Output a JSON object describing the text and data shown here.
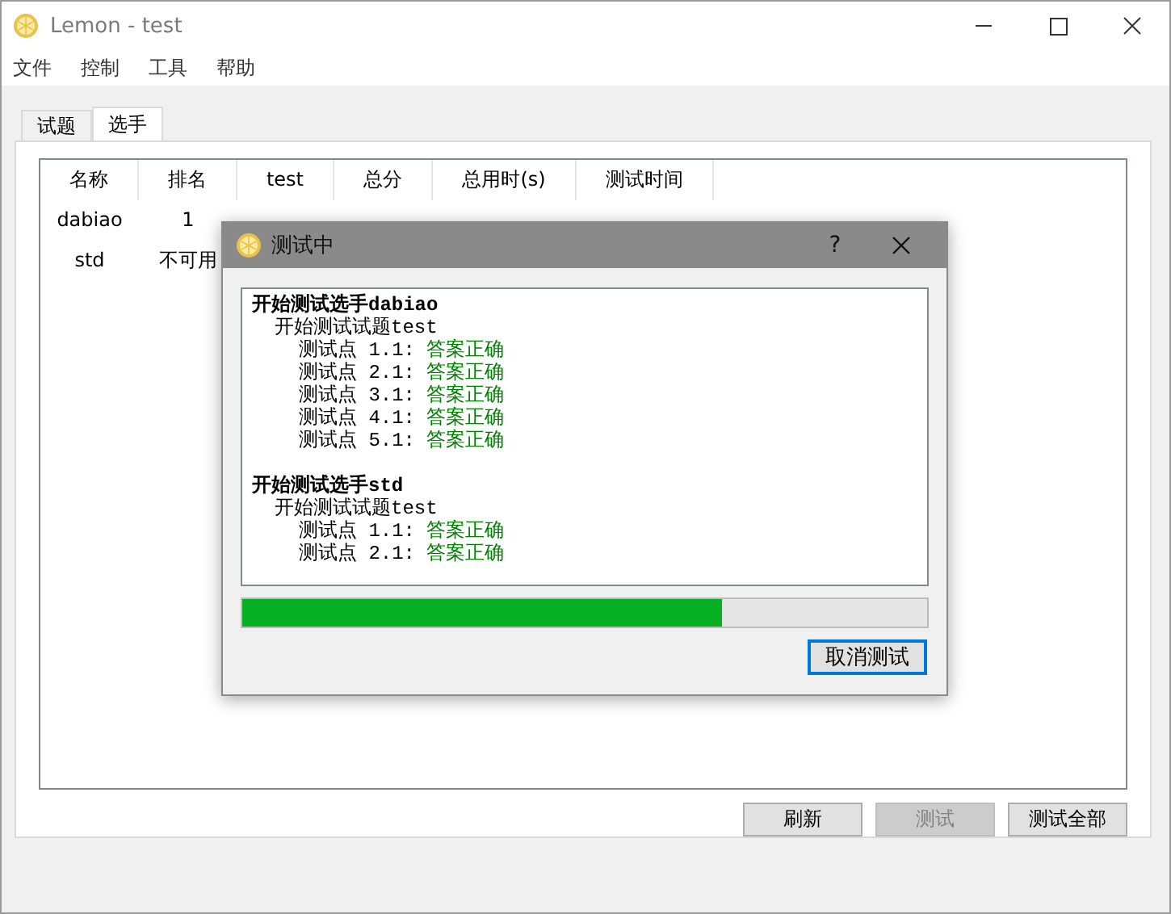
{
  "window": {
    "title": "Lemon - test",
    "active": false
  },
  "menu": [
    "文件",
    "控制",
    "工具",
    "帮助"
  ],
  "tabs": [
    {
      "label": "试题",
      "selected": false
    },
    {
      "label": "选手",
      "selected": true
    }
  ],
  "table": {
    "columns": [
      "名称",
      "排名",
      "test",
      "总分",
      "总用时(s)",
      "测试时间"
    ],
    "rows": [
      [
        "dabiao",
        "1"
      ],
      [
        "std",
        "不可用"
      ]
    ]
  },
  "buttons": [
    {
      "label": "刷新",
      "disabled": false
    },
    {
      "label": "测试",
      "disabled": true
    },
    {
      "label": "测试全部",
      "disabled": false
    }
  ],
  "dialog": {
    "title": "测试中",
    "help": "?",
    "log": [
      {
        "contestant": "开始测试选手dabiao",
        "problems": [
          {
            "title": "开始测试试题test",
            "points": [
              {
                "label": "测试点 1.1:",
                "result": "答案正确",
                "kind": "correct"
              },
              {
                "label": "测试点 2.1:",
                "result": "答案正确",
                "kind": "correct"
              },
              {
                "label": "测试点 3.1:",
                "result": "答案正确",
                "kind": "correct"
              },
              {
                "label": "测试点 4.1:",
                "result": "答案正确",
                "kind": "correct"
              },
              {
                "label": "测试点 5.1:",
                "result": "答案正确",
                "kind": "correct"
              }
            ]
          }
        ]
      },
      {
        "contestant": "开始测试选手std",
        "problems": [
          {
            "title": "开始测试试题test",
            "points": [
              {
                "label": "测试点 1.1:",
                "result": "答案正确",
                "kind": "correct"
              },
              {
                "label": "测试点 2.1:",
                "result": "答案正确",
                "kind": "correct"
              }
            ]
          }
        ]
      }
    ],
    "progress": {
      "level": 0.7
    },
    "cancel": {
      "label": "取消测试",
      "focused": true
    }
  }
}
